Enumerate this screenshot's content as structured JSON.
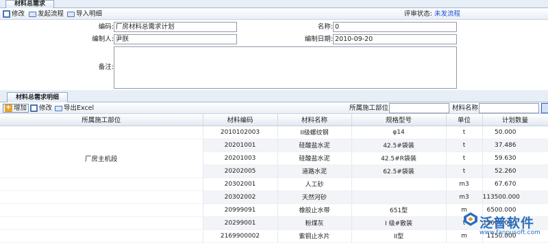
{
  "header": {
    "tab_title": "材料总需求"
  },
  "toolbar": {
    "edit_label": "修改",
    "start_flow_label": "发起流程",
    "import_label": "导入明细",
    "status_label": "评审状态:",
    "status_value": "未发流程"
  },
  "form": {
    "code_label": "编码:",
    "code_value": "厂房材料总需求计划",
    "name_label": "名称:",
    "name_value": "0",
    "creator_label": "编制人:",
    "creator_value": "尹朕",
    "date_label": "编制日期:",
    "date_value": "2010-09-20",
    "remark_label": "备注:",
    "remark_value": ""
  },
  "detail": {
    "tab_title": "材料总需求明细",
    "add_label": "增加",
    "edit_label": "修改",
    "export_label": "导出Excel",
    "filter_dept_label": "所属施工部位:",
    "filter_dept_value": "",
    "filter_name_label": "材料名称:",
    "filter_name_value": ""
  },
  "table": {
    "columns": [
      "所属施工部位",
      "材料编码",
      "材料名称",
      "规格型号",
      "单位",
      "计划数量"
    ],
    "dept_merged": "厂房主机段",
    "rows": [
      [
        "",
        "2010102003",
        "II级螺纹钢",
        "φ14",
        "t",
        "50.000"
      ],
      [
        "厂房主机段",
        "20201001",
        "硅酸盐水泥",
        "42.5#袋装",
        "t",
        "37.486"
      ],
      [
        "厂房主机段",
        "20201003",
        "硅酸盐水泥",
        "42.5#R袋装",
        "t",
        "59.630"
      ],
      [
        "厂房主机段",
        "20202005",
        "道路水泥",
        "62.5#袋装",
        "t",
        "52.260"
      ],
      [
        "厂房主机段",
        "20302001",
        "人工砂",
        "",
        "m3",
        "67.670"
      ],
      [
        "厂房主机段",
        "20302002",
        "天然河砂",
        "",
        "m3",
        "113500.000"
      ],
      [
        "厂房主机段",
        "20999091",
        "橡胶止水带",
        "651型",
        "m",
        "6500.000"
      ],
      [
        "厂房主机段",
        "20299001",
        "粉煤灰",
        "I 级#散装",
        "t",
        "12600.000"
      ],
      [
        "厂房主机段",
        "2169900002",
        "紫铜止水片",
        "II型",
        "m",
        "1150.000"
      ]
    ]
  },
  "watermark": {
    "brand": "泛普软件",
    "url": "www.fanpusoft.com"
  }
}
